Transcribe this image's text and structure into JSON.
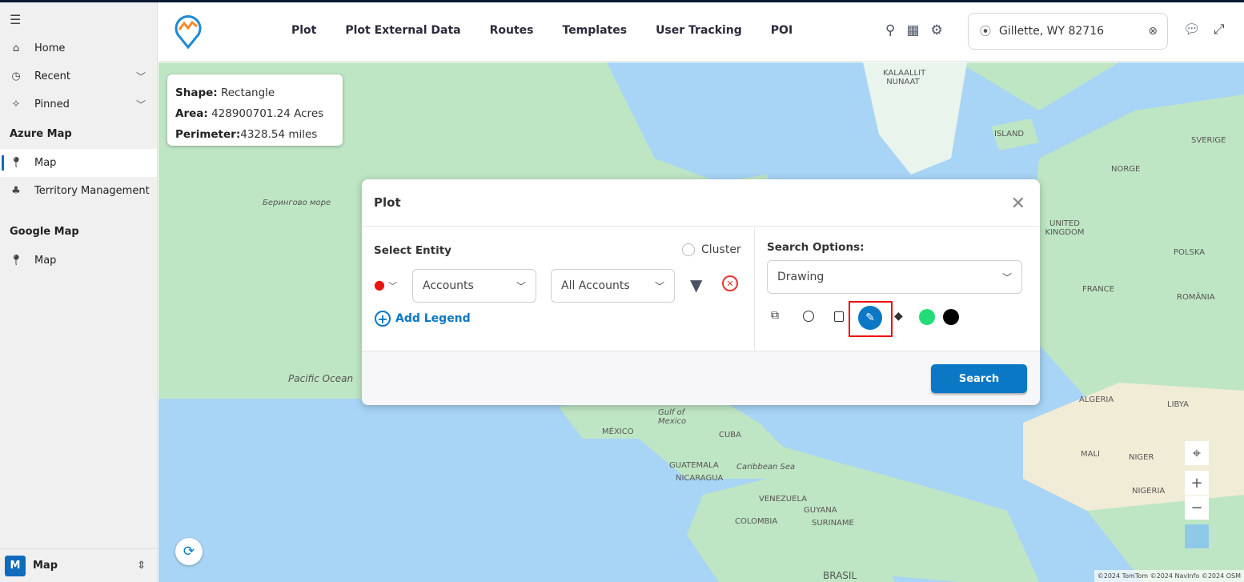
{
  "sidebar": {
    "items": [
      {
        "label": "Home",
        "icon": "home-icon"
      },
      {
        "label": "Recent",
        "icon": "clock-icon"
      },
      {
        "label": "Pinned",
        "icon": "pin-icon"
      }
    ],
    "sections": [
      {
        "title": "Azure Map",
        "items": [
          {
            "label": "Map"
          },
          {
            "label": "Territory Management"
          }
        ]
      },
      {
        "title": "Google Map",
        "items": [
          {
            "label": "Map"
          }
        ]
      }
    ],
    "bottom": {
      "badge": "M",
      "label": "Map"
    }
  },
  "header": {
    "nav": [
      "Plot",
      "Plot External Data",
      "Routes",
      "Templates",
      "User Tracking",
      "POI"
    ],
    "location": "Gillette, WY 82716"
  },
  "tooltip": {
    "shape_label": "Shape:",
    "shape": "Rectangle",
    "area_label": "Area:",
    "area": "428900701.24 Acres",
    "perimeter_label": "Perimeter:",
    "perimeter": "4328.54 miles"
  },
  "modal": {
    "title": "Plot",
    "select_entity": "Select Entity",
    "cluster": "Cluster",
    "entity": "Accounts",
    "view": "All Accounts",
    "add_legend": "Add Legend",
    "search_options": "Search Options:",
    "search_option": "Drawing",
    "search_button": "Search",
    "colors": {
      "fill": "#22dd77",
      "stroke": "#000000",
      "accent": "#0a78c5"
    }
  },
  "map": {
    "labels": [
      "KALAALLIT NUNAAT",
      "ISLAND",
      "Берингово море",
      "Pacific Ocean",
      "Gulf of Mexico",
      "MÉXICO",
      "CUBA",
      "GUATEMALA",
      "NICARAGUA",
      "Caribbean Sea",
      "VENEZUELA",
      "COLOMBIA",
      "GUYANA",
      "SURINAME",
      "BRASIL",
      "ALGERIA",
      "LIBYA",
      "MALI",
      "NIGER",
      "NIGERIA",
      "FRANCE",
      "UNITED KINGDOM",
      "NORGE",
      "SVERIGE",
      "POLSKA",
      "ROMÂNIA"
    ],
    "attribution": "©2024 TomTom ©2024 NavInfo ©2024 OSM"
  }
}
